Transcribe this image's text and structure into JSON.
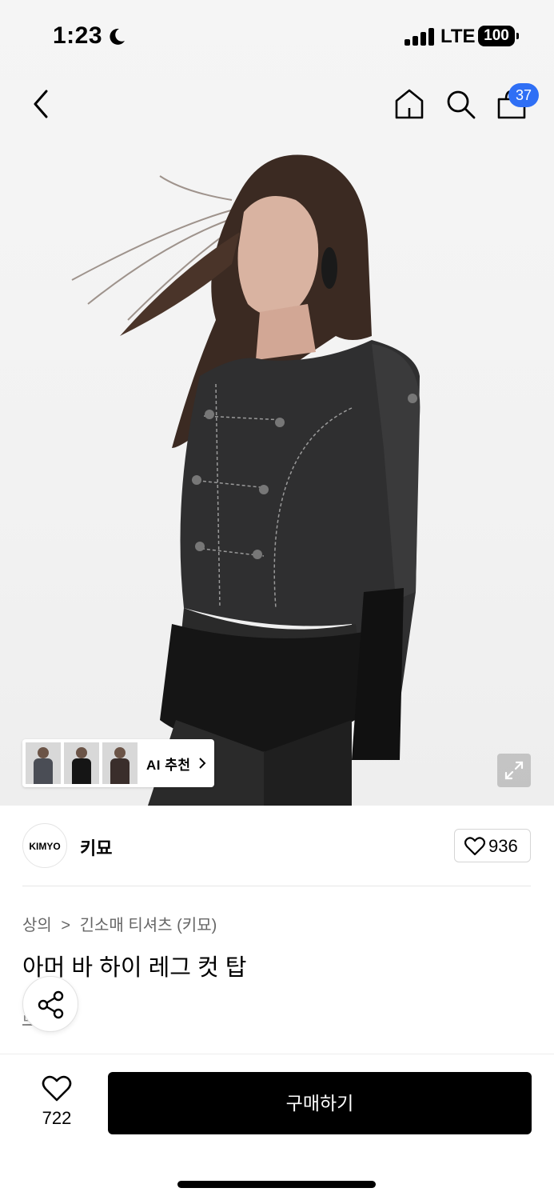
{
  "status": {
    "time": "1:23",
    "network": "LTE",
    "battery": "100"
  },
  "nav": {
    "cart_count": "37"
  },
  "ai_recommend": {
    "label": "AI 추천",
    "thumbnail_count": 3
  },
  "brand": {
    "logo_text": "KIMYO",
    "name": "키묘",
    "likes": "936"
  },
  "breadcrumb": {
    "category": "상의",
    "subcategory": "긴소매 티셔츠 (키묘)"
  },
  "product": {
    "title": "아머 바 하이 레그 컷 탑",
    "partial_link": "리뷰"
  },
  "bottom": {
    "wish_count": "722",
    "buy_label": "구매하기"
  },
  "colors": {
    "accent_badge": "#2f6ff5",
    "buy_button": "#000000"
  },
  "icons": [
    "back-icon",
    "home-icon",
    "search-icon",
    "bag-icon",
    "expand-icon",
    "share-icon",
    "heart-icon",
    "moon-icon"
  ]
}
